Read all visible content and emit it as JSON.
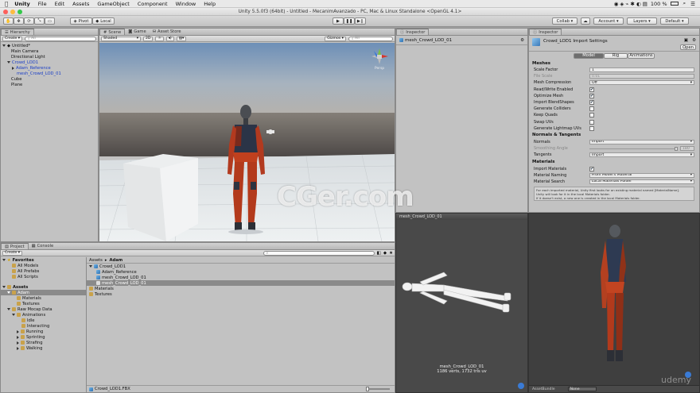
{
  "mac_menu": {
    "app": "Unity",
    "items": [
      "File",
      "Edit",
      "Assets",
      "GameObject",
      "Component",
      "Window",
      "Help"
    ],
    "status": "100 %"
  },
  "title": "Unity 5.5.0f3 (64bit) - Untitled - MecanimAvanzado - PC, Mac & Linux Standalone <OpenGL 4.1>",
  "toolbar": {
    "pivot": "Pivot",
    "local": "Local",
    "collab": "Collab",
    "account": "Account",
    "layers": "Layers",
    "layout": "Default"
  },
  "hierarchy": {
    "tab": "Hierarchy",
    "create": "Create",
    "search_placeholder": "All",
    "scene": "Untitled*",
    "items": [
      "Main Camera",
      "Directional Light",
      "Crowd_LOD1",
      "Adam_Reference",
      "mesh_Crowd_LOD_01",
      "Cube",
      "Plane"
    ]
  },
  "scene": {
    "tabs": [
      "Scene",
      "Game",
      "Asset Store"
    ],
    "shading": "Shaded",
    "mode_2d": "2D",
    "gizmos": "Gizmos",
    "search_placeholder": "All",
    "persp": "Persp"
  },
  "inspector1": {
    "tab": "Inspector",
    "name": "mesh_Crowd_LOD_01"
  },
  "inspector2": {
    "tab": "Inspector",
    "title": "Crowd_LOD1 Import Settings",
    "open": "Open",
    "subtabs": [
      "Model",
      "Rig",
      "Animations"
    ],
    "meshes_header": "Meshes",
    "meshes": [
      {
        "label": "Scale Factor",
        "value": "1"
      },
      {
        "label": "File Scale",
        "value": "0.01"
      },
      {
        "label": "Mesh Compression",
        "value": "Off"
      },
      {
        "label": "Read/Write Enabled",
        "check": "✔"
      },
      {
        "label": "Optimize Mesh",
        "check": "✔"
      },
      {
        "label": "Import BlendShapes",
        "check": "✔"
      },
      {
        "label": "Generate Colliders",
        "check": ""
      },
      {
        "label": "Keep Quads",
        "check": ""
      },
      {
        "label": "Swap UVs",
        "check": ""
      },
      {
        "label": "Generate Lightmap UVs",
        "check": ""
      }
    ],
    "normals_header": "Normals & Tangents",
    "normals": [
      {
        "label": "Normals",
        "value": "Import"
      },
      {
        "label": "Smoothing Angle",
        "value": "180"
      },
      {
        "label": "Tangents",
        "value": "Import"
      }
    ],
    "materials_header": "Materials",
    "materials": [
      {
        "label": "Import Materials",
        "check": "✔"
      },
      {
        "label": "Material Naming",
        "value": "From Model's Material"
      },
      {
        "label": "Material Search",
        "value": "Local Materials Folder"
      }
    ],
    "help_lines": [
      "For each imported material, Unity first looks for an existing material named [MaterialName].",
      "Unity will look for it in the local Materials folder.",
      "If it doesn't exist, a new one is created in the local Materials folder."
    ]
  },
  "preview1": {
    "header": "mesh_Crowd_LOD_01",
    "caption1": "mesh_Crowd_LOD_01",
    "caption2": "1186 verts, 1732 tris   uv"
  },
  "preview2": {
    "assetbundle": "AssetBundle",
    "none": "None"
  },
  "project": {
    "tabs": [
      "Project",
      "Console"
    ],
    "create": "Create",
    "favorites_header": "Favorites",
    "favorites": [
      "All Models",
      "All Prefabs",
      "All Scripts"
    ],
    "assets_header": "Assets",
    "tree": [
      {
        "label": "Adam",
        "depth": 1,
        "selected": true
      },
      {
        "label": "Materials",
        "depth": 2
      },
      {
        "label": "Textures",
        "depth": 2
      },
      {
        "label": "Raw Mocap Data",
        "depth": 1
      },
      {
        "label": "Animations",
        "depth": 2
      },
      {
        "label": "Idle",
        "depth": 3
      },
      {
        "label": "Interacting",
        "depth": 3
      },
      {
        "label": "Running",
        "depth": 3
      },
      {
        "label": "Sprinting",
        "depth": 3
      },
      {
        "label": "Strafing",
        "depth": 3
      },
      {
        "label": "Walking",
        "depth": 3
      }
    ],
    "breadcrumb": [
      "Assets",
      "Adam"
    ],
    "files": [
      {
        "label": "Crowd_LOD1",
        "depth": 0
      },
      {
        "label": "Adam_Reference",
        "depth": 1
      },
      {
        "label": "mesh_Crowd_LOD_01",
        "depth": 1
      },
      {
        "label": "mesh_Crowd_LOD_01",
        "depth": 1,
        "selected": true
      },
      {
        "label": "Materials",
        "depth": 0
      },
      {
        "label": "Textures",
        "depth": 0
      }
    ],
    "footer_file": "Crowd_LOD1.FBX"
  },
  "watermark": "CGer.com",
  "udemy": "udemy"
}
